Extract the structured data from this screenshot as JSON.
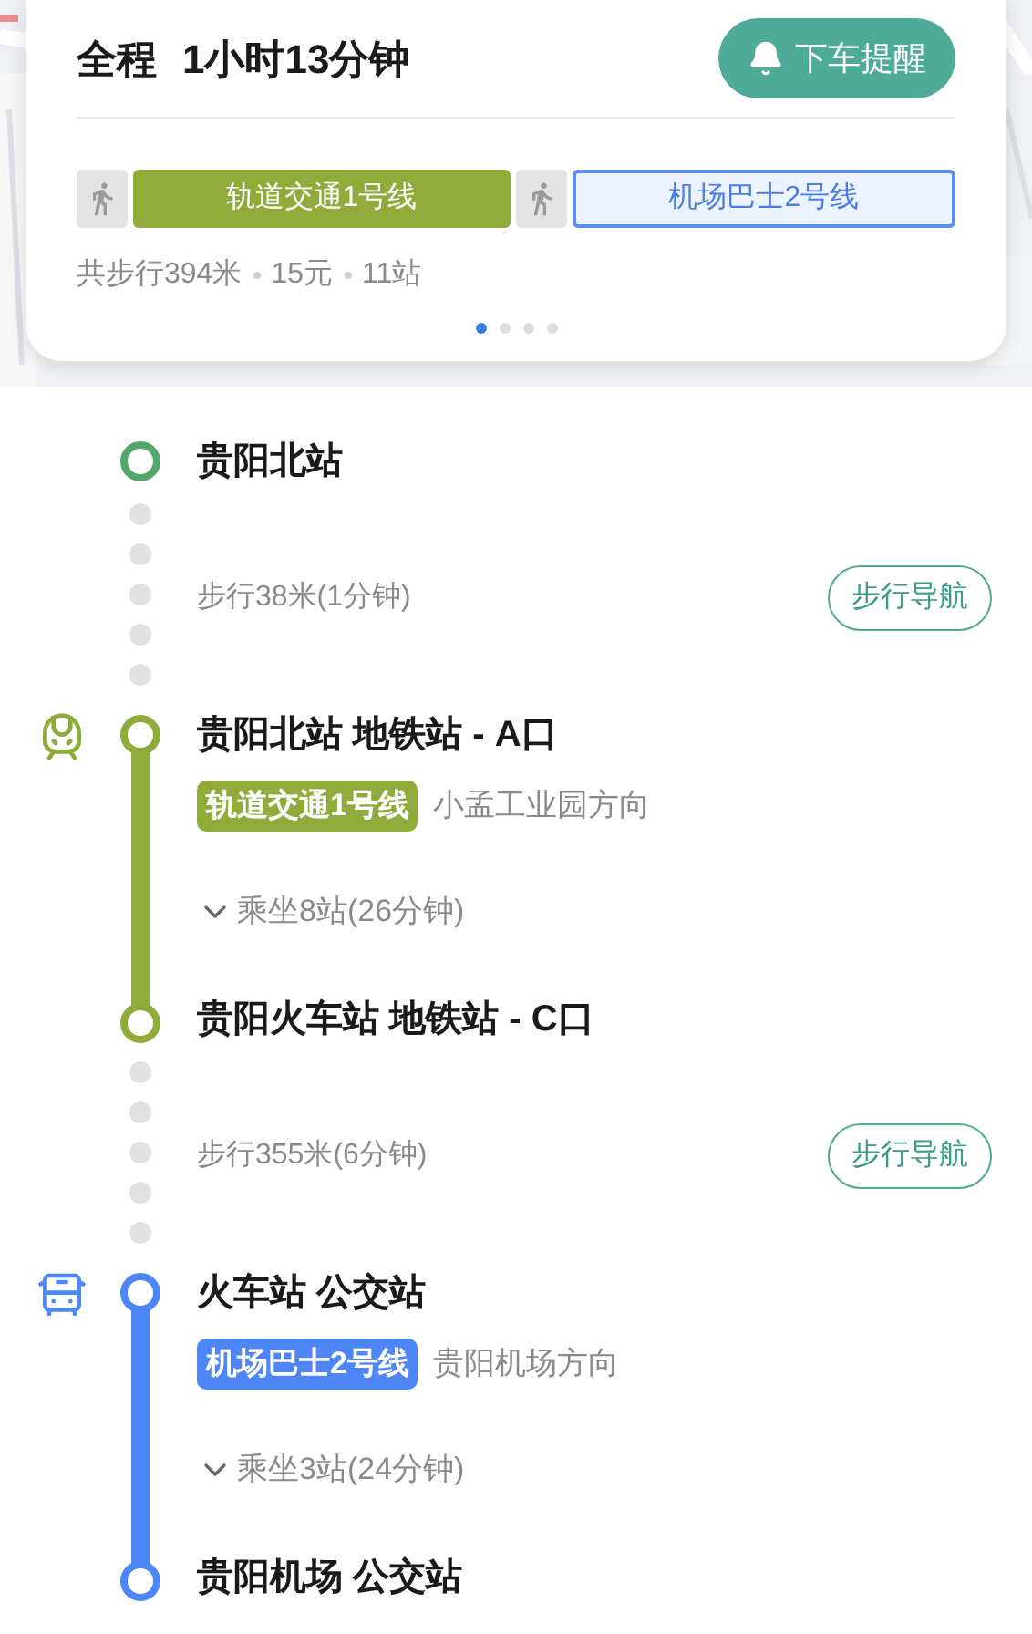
{
  "summary": {
    "label": "全程",
    "duration": "1小时13分钟",
    "alert_button": "下车提醒",
    "segments": [
      {
        "kind": "walk"
      },
      {
        "kind": "rail",
        "label": "轨道交通1号线"
      },
      {
        "kind": "walk"
      },
      {
        "kind": "bus",
        "label": "机场巴士2号线"
      }
    ],
    "stats": [
      "共步行394米",
      "15元",
      "11站"
    ],
    "pages": [
      {
        "selected": true
      },
      {
        "selected": false
      },
      {
        "selected": false
      },
      {
        "selected": false
      }
    ]
  },
  "steps": [
    {
      "kind": "start",
      "name": "贵阳北站"
    },
    {
      "kind": "walk",
      "text": "步行38米(1分钟)",
      "button": "步行导航"
    },
    {
      "kind": "rail",
      "color": "#8fac3b",
      "board": "贵阳北站 地铁站 - A口",
      "line": "轨道交通1号线",
      "direction": "小孟工业园方向",
      "stops": "乘坐8站(26分钟)",
      "alight": "贵阳火车站 地铁站 - C口"
    },
    {
      "kind": "walk",
      "text": "步行355米(6分钟)",
      "button": "步行导航"
    },
    {
      "kind": "bus",
      "color": "#4f86f7",
      "board": "火车站 公交站",
      "line": "机场巴士2号线",
      "direction": "贵阳机场方向",
      "stops": "乘坐3站(24分钟)",
      "alight": "贵阳机场 公交站"
    }
  ]
}
